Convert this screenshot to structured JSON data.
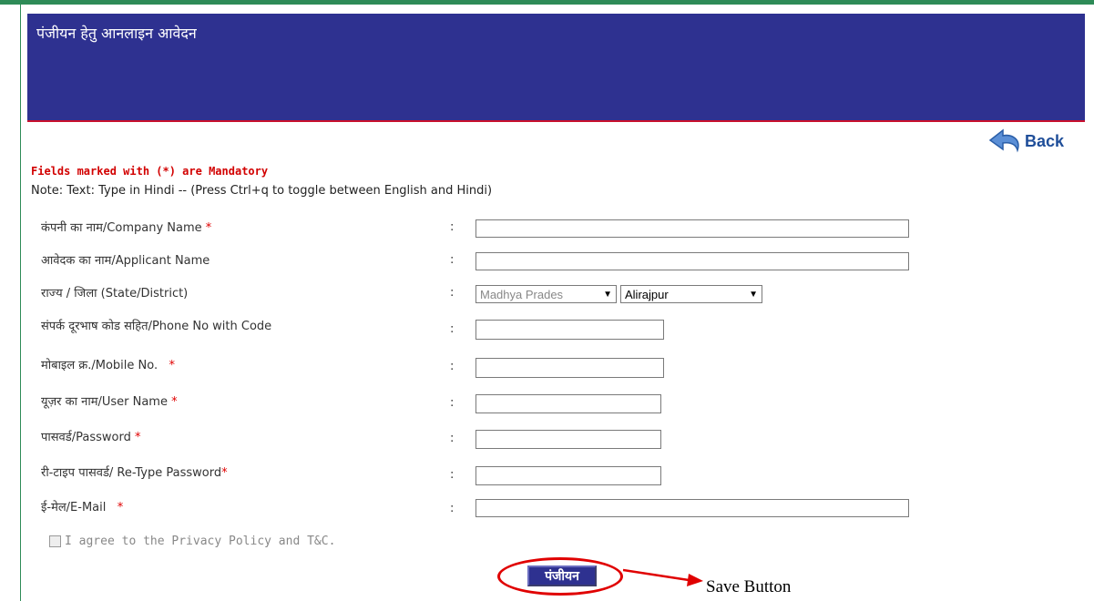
{
  "header": {
    "title": "पंजीयन हेतु आनलाइन आवेदन"
  },
  "back": {
    "label": "Back"
  },
  "mandatory_note": "Fields marked with (*) are Mandatory",
  "hindi_note": "Note: Text: Type in Hindi -- (Press Ctrl+q to toggle between English and Hindi)",
  "form": {
    "colon": ":",
    "company_name": {
      "label": "कंपनी का नाम/Company Name",
      "star": "*",
      "value": ""
    },
    "applicant_name": {
      "label": "आवेदक का नाम/Applicant Name",
      "value": ""
    },
    "state_district": {
      "label": "राज्य / जिला (State/District)",
      "state": "Madhya Prades",
      "district": "Alirajpur"
    },
    "phone": {
      "label": "संपर्क दूरभाष कोड सहित/Phone No with Code",
      "value": ""
    },
    "mobile": {
      "label": "मोबाइल क्र./Mobile No.",
      "star": "*",
      "value": ""
    },
    "username": {
      "label": "यूज़र का नाम/User Name",
      "star": "*",
      "value": ""
    },
    "password": {
      "label": "पासवर्ड/Password",
      "star": "*",
      "value": ""
    },
    "retype_password": {
      "label": "री-टाइप पासवर्ड/ Re-Type Password",
      "star": "*",
      "value": ""
    },
    "email": {
      "label": "ई-मेल/E-Mail",
      "star": "*",
      "value": ""
    },
    "agree": {
      "label": "I agree to the Privacy Policy and T&C.",
      "checked": false
    },
    "submit": {
      "label": "पंजीयन"
    }
  },
  "annotation": {
    "text": "Save Button",
    "color": "#e00000"
  },
  "colors": {
    "header_bg": "#2e3190",
    "accent_red": "#c8102e",
    "green_border": "#2e8b57"
  }
}
